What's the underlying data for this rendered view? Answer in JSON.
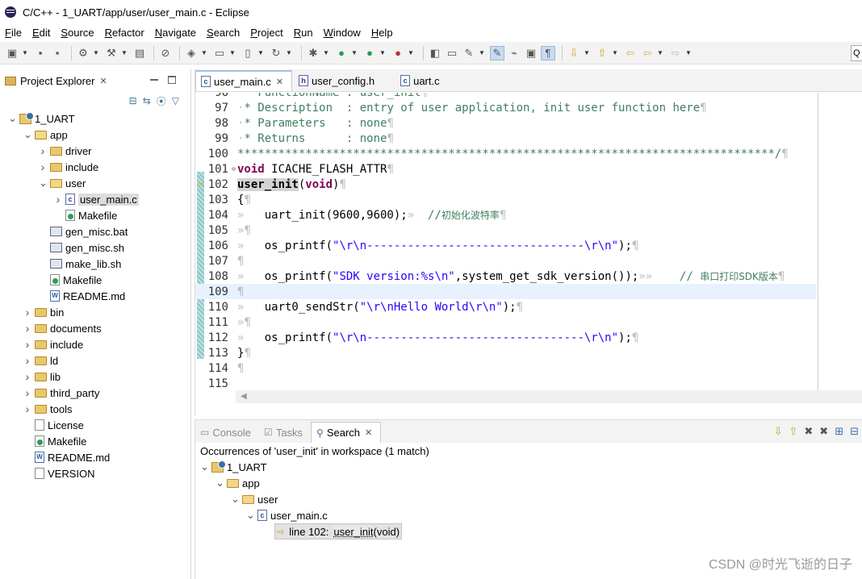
{
  "window": {
    "title": "C/C++ - 1_UART/app/user/user_main.c - Eclipse"
  },
  "menubar": [
    "File",
    "Edit",
    "Source",
    "Refactor",
    "Navigate",
    "Search",
    "Project",
    "Run",
    "Window",
    "Help"
  ],
  "quick_access": {
    "label": "Q"
  },
  "project_explorer": {
    "title": "Project Explorer",
    "tree": [
      {
        "label": "1_UART",
        "icon": "project-icon",
        "depth": 0,
        "expanded": true
      },
      {
        "label": "app",
        "icon": "folder-open-icon",
        "depth": 1,
        "expanded": true
      },
      {
        "label": "driver",
        "icon": "folder-icon",
        "depth": 2,
        "expanded": false
      },
      {
        "label": "include",
        "icon": "folder-icon",
        "depth": 2,
        "expanded": false
      },
      {
        "label": "user",
        "icon": "folder-open-icon",
        "depth": 2,
        "expanded": true
      },
      {
        "label": "user_main.c",
        "icon": "c-file-icon",
        "depth": 3,
        "expanded": false,
        "selected": true
      },
      {
        "label": "Makefile",
        "icon": "makefile-icon",
        "depth": 3
      },
      {
        "label": "gen_misc.bat",
        "icon": "script-file-icon",
        "depth": 2
      },
      {
        "label": "gen_misc.sh",
        "icon": "script-file-icon",
        "depth": 2
      },
      {
        "label": "make_lib.sh",
        "icon": "script-file-icon",
        "depth": 2
      },
      {
        "label": "Makefile",
        "icon": "makefile-icon",
        "depth": 2
      },
      {
        "label": "README.md",
        "icon": "markdown-file-icon",
        "depth": 2
      },
      {
        "label": "bin",
        "icon": "folder-icon",
        "depth": 1,
        "expanded": false
      },
      {
        "label": "documents",
        "icon": "folder-icon",
        "depth": 1,
        "expanded": false
      },
      {
        "label": "include",
        "icon": "folder-icon",
        "depth": 1,
        "expanded": false
      },
      {
        "label": "ld",
        "icon": "folder-icon",
        "depth": 1,
        "expanded": false
      },
      {
        "label": "lib",
        "icon": "folder-icon",
        "depth": 1,
        "expanded": false
      },
      {
        "label": "third_party",
        "icon": "folder-icon",
        "depth": 1,
        "expanded": false
      },
      {
        "label": "tools",
        "icon": "folder-icon",
        "depth": 1,
        "expanded": false
      },
      {
        "label": "License",
        "icon": "text-file-icon",
        "depth": 1
      },
      {
        "label": "Makefile",
        "icon": "makefile-icon",
        "depth": 1
      },
      {
        "label": "README.md",
        "icon": "markdown-file-icon",
        "depth": 1
      },
      {
        "label": "VERSION",
        "icon": "text-file-icon",
        "depth": 1
      }
    ]
  },
  "editor": {
    "tabs": [
      {
        "label": "user_main.c",
        "icon": "c-file-icon",
        "active": true
      },
      {
        "label": "user_config.h",
        "icon": "h-file-icon",
        "active": false
      },
      {
        "label": "uart.c",
        "icon": "c-file-icon",
        "active": false
      }
    ],
    "lines": [
      {
        "n": "96",
        "segs": [
          [
            "ws",
            "·"
          ],
          [
            "cm",
            "* FunctionName : user_init"
          ],
          [
            "ws",
            "¶"
          ]
        ]
      },
      {
        "n": "97",
        "segs": [
          [
            "ws",
            "·"
          ],
          [
            "cm",
            "* Description  : entry of user application, init user function here"
          ],
          [
            "ws",
            "¶"
          ]
        ]
      },
      {
        "n": "98",
        "segs": [
          [
            "ws",
            "·"
          ],
          [
            "cm",
            "* Parameters   : none"
          ],
          [
            "ws",
            "¶"
          ]
        ]
      },
      {
        "n": "99",
        "segs": [
          [
            "ws",
            "·"
          ],
          [
            "cm",
            "* Returns      : none"
          ],
          [
            "ws",
            "¶"
          ]
        ]
      },
      {
        "n": "100",
        "segs": [
          [
            "cm",
            "*******************************************************************************/"
          ],
          [
            "ws",
            "¶"
          ]
        ]
      },
      {
        "n": "101",
        "fold": true,
        "segs": [
          [
            "kw",
            "void"
          ],
          [
            "",
            " ICACHE_FLASH_ATTR"
          ],
          [
            "ws",
            "¶"
          ]
        ]
      },
      {
        "n": "102",
        "current_marker": true,
        "segs": [
          [
            "kwb",
            "user_init"
          ],
          [
            "",
            "("
          ],
          [
            "kw",
            "void"
          ],
          [
            "",
            ")"
          ],
          [
            "ws",
            "¶"
          ]
        ]
      },
      {
        "n": "103",
        "segs": [
          [
            "",
            "{"
          ],
          [
            "ws",
            "¶"
          ]
        ]
      },
      {
        "n": "104",
        "segs": [
          [
            "ws",
            "»   "
          ],
          [
            "",
            "uart_init(9600,9600);"
          ],
          [
            "ws",
            "»  "
          ],
          [
            "cm",
            "//"
          ],
          [
            "cmcn",
            "初始化波特率"
          ],
          [
            "ws",
            "¶"
          ]
        ]
      },
      {
        "n": "105",
        "segs": [
          [
            "ws",
            "»"
          ],
          [
            "ws",
            "¶"
          ]
        ]
      },
      {
        "n": "106",
        "segs": [
          [
            "ws",
            "»   "
          ],
          [
            "",
            "os_printf("
          ],
          [
            "str",
            "\"\\r\\n--------------------------------\\r\\n\""
          ],
          [
            "",
            ");"
          ],
          [
            "ws",
            "¶"
          ]
        ]
      },
      {
        "n": "107",
        "segs": [
          [
            "ws",
            "¶"
          ]
        ]
      },
      {
        "n": "108",
        "segs": [
          [
            "ws",
            "»   "
          ],
          [
            "",
            "os_printf("
          ],
          [
            "str",
            "\"SDK version:%s\\n\""
          ],
          [
            "",
            ",system_get_sdk_version());"
          ],
          [
            "ws",
            "»»    "
          ],
          [
            "cm",
            "// "
          ],
          [
            "cmcn",
            "串口打印SDK版本"
          ],
          [
            "ws",
            "¶"
          ]
        ]
      },
      {
        "n": "109",
        "current": true,
        "segs": [
          [
            "ws",
            "¶"
          ]
        ]
      },
      {
        "n": "110",
        "segs": [
          [
            "ws",
            "»   "
          ],
          [
            "",
            "uart0_sendStr("
          ],
          [
            "str",
            "\"\\r\\nHello World\\r\\n\""
          ],
          [
            "",
            ");"
          ],
          [
            "ws",
            "¶"
          ]
        ]
      },
      {
        "n": "111",
        "segs": [
          [
            "ws",
            "»"
          ],
          [
            "ws",
            "¶"
          ]
        ]
      },
      {
        "n": "112",
        "segs": [
          [
            "ws",
            "»   "
          ],
          [
            "",
            "os_printf("
          ],
          [
            "str",
            "\"\\r\\n--------------------------------\\r\\n\""
          ],
          [
            "",
            ");"
          ],
          [
            "ws",
            "¶"
          ]
        ]
      },
      {
        "n": "113",
        "segs": [
          [
            "",
            "}"
          ],
          [
            "ws",
            "¶"
          ]
        ]
      },
      {
        "n": "114",
        "segs": [
          [
            "ws",
            "¶"
          ]
        ]
      },
      {
        "n": "115",
        "segs": []
      }
    ]
  },
  "bottom_panel": {
    "tabs": [
      {
        "label": "Console",
        "active": false
      },
      {
        "label": "Tasks",
        "active": false
      },
      {
        "label": "Search",
        "active": true
      }
    ],
    "summary": "Occurrences of 'user_init' in workspace (1 match)",
    "results": [
      {
        "label": "1_UART",
        "icon": "project-icon",
        "depth": 0
      },
      {
        "label": "app",
        "icon": "folder-open-icon",
        "depth": 1
      },
      {
        "label": "user",
        "icon": "folder-open-icon",
        "depth": 2
      },
      {
        "label": "user_main.c",
        "icon": "c-file-icon",
        "depth": 3
      }
    ],
    "match": {
      "prefix": "line 102:",
      "match_text": "user_init",
      "suffix": "(void)"
    }
  },
  "watermark": "CSDN @时光飞逝的日子"
}
